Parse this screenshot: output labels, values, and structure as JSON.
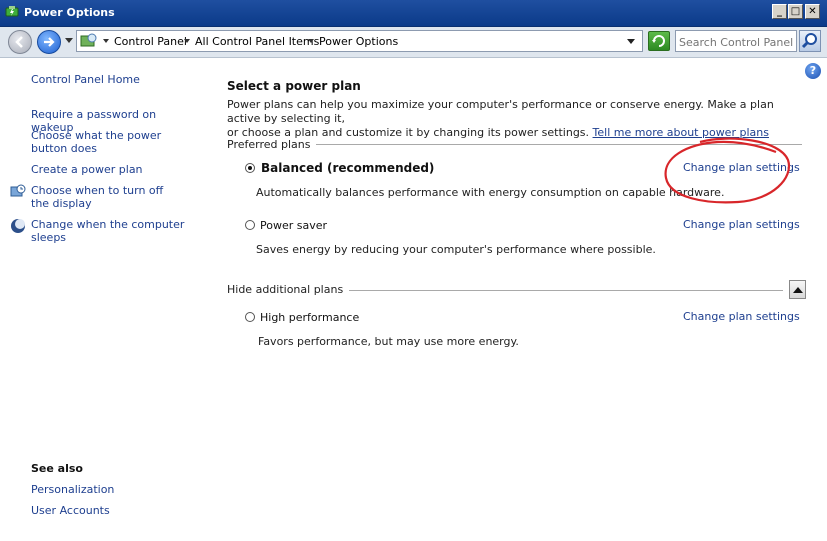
{
  "window": {
    "title": "Power Options",
    "buttons": {
      "minimize": "_",
      "maximize": "□",
      "close": "✕"
    }
  },
  "address_bar": {
    "breadcrumbs": [
      "Control Panel",
      "All Control Panel Items",
      "Power Options"
    ],
    "search_placeholder": "Search Control Panel"
  },
  "sidebar": {
    "home": "Control Panel Home",
    "links": [
      "Require a password on wakeup",
      "Choose what the power button does",
      "Create a power plan",
      "Choose when to turn off the display",
      "Change when the computer sleeps"
    ],
    "see_also_title": "See also",
    "see_also": [
      "Personalization",
      "User Accounts"
    ]
  },
  "main": {
    "heading": "Select a power plan",
    "description": "Power plans can help you maximize your computer's performance or conserve energy. Make a plan active by selecting it, or choose a plan and customize it by selecting it by changing its power settings.",
    "description_line1": "Power plans can help you maximize your computer's performance or conserve energy. Make a plan active by selecting it,",
    "description_line2": "or choose a plan and customize it by changing its power settings.",
    "learn_more": "Tell me more about power plans",
    "preferred_label": "Preferred plans",
    "hidden_label": "Hide additional plans",
    "plans": [
      {
        "name": "Balanced (recommended)",
        "description": "Automatically balances performance with energy consumption on capable hardware.",
        "action": "Change plan settings",
        "selected": true
      },
      {
        "name": "Power saver",
        "description": "Saves energy by reducing your computer's performance where possible.",
        "action": "Change plan settings",
        "selected": false
      },
      {
        "name": "High performance",
        "description": "Favors performance, but may use more energy.",
        "action": "Change plan settings",
        "selected": false
      }
    ]
  },
  "colors": {
    "title_bar": "#0b3a89",
    "link": "#1e3f8f",
    "annotation": "#d8262a"
  }
}
